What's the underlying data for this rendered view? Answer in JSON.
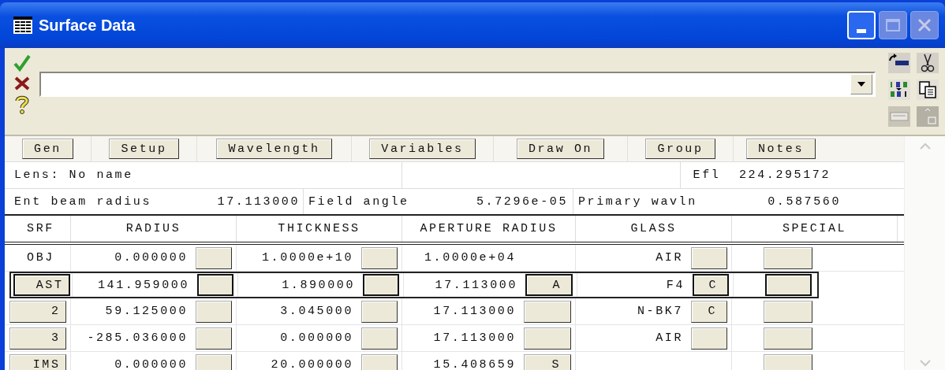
{
  "window": {
    "title": "Surface Data"
  },
  "tab_buttons": [
    "Gen",
    "Setup",
    "Wavelength",
    "Variables",
    "Draw On",
    "Group",
    "Notes"
  ],
  "summary": {
    "lens_label": "Lens: No name",
    "efl_label": "Efl",
    "efl_value": "224.295172",
    "ent_beam_label": "Ent beam radius",
    "ent_beam_value": "17.113000",
    "field_angle_label": "Field angle",
    "field_angle_value": "5.7296e-05",
    "primary_wavln_label": "Primary wavln",
    "primary_wavln_value": "0.587560"
  },
  "columns": [
    "SRF",
    "RADIUS",
    "THICKNESS",
    "APERTURE RADIUS",
    "GLASS",
    "SPECIAL"
  ],
  "rows": [
    {
      "surface": "OBJ",
      "surface_button": false,
      "selected": false,
      "radius": {
        "value": "0.000000",
        "solve": true
      },
      "thickness": {
        "value": "1.0000e+10",
        "solve": true
      },
      "aperture": {
        "value": "1.0000e+04",
        "solve": false
      },
      "glass": {
        "value": "AIR",
        "solve": true
      },
      "special": {
        "solve": true
      }
    },
    {
      "surface": "AST",
      "surface_button": true,
      "selected": true,
      "radius": {
        "value": "141.959000",
        "solve": true
      },
      "thickness": {
        "value": "1.890000",
        "solve": true
      },
      "aperture": {
        "value": "17.113000",
        "solve": true,
        "solve_label": "A"
      },
      "glass": {
        "value": "F4",
        "solve": true,
        "solve_label": "C"
      },
      "special": {
        "solve": true
      }
    },
    {
      "surface": "2",
      "surface_button": true,
      "selected": false,
      "radius": {
        "value": "59.125000",
        "solve": true
      },
      "thickness": {
        "value": "3.045000",
        "solve": true
      },
      "aperture": {
        "value": "17.113000",
        "solve": true
      },
      "glass": {
        "value": "N-BK7",
        "solve": true,
        "solve_label": "C"
      },
      "special": {
        "solve": true
      }
    },
    {
      "surface": "3",
      "surface_button": true,
      "selected": false,
      "radius": {
        "value": "-285.036000",
        "solve": true
      },
      "thickness": {
        "value": "0.000000",
        "solve": true
      },
      "aperture": {
        "value": "17.113000",
        "solve": true
      },
      "glass": {
        "value": "AIR",
        "solve": true
      },
      "special": {
        "solve": true
      }
    },
    {
      "surface": "IMS",
      "surface_button": true,
      "selected": false,
      "radius": {
        "value": "0.000000",
        "solve": true
      },
      "thickness": {
        "value": "20.000000",
        "solve": true
      },
      "aperture": {
        "value": "15.408659",
        "solve": true,
        "solve_label": "S"
      },
      "glass": {
        "solve": false
      },
      "special": {
        "solve": true
      }
    }
  ]
}
